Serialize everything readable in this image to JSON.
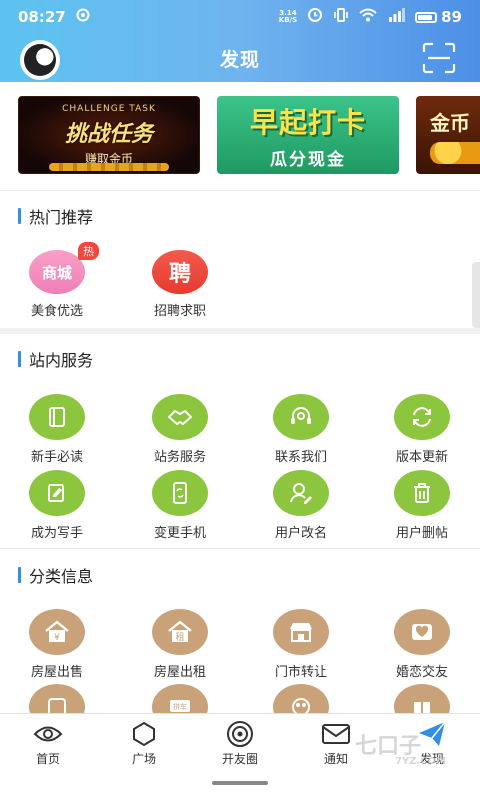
{
  "status_bar": {
    "time": "08:27",
    "net_speed_value": "3.14",
    "net_speed_unit": "KB/S",
    "battery": "89"
  },
  "header": {
    "title": "发现"
  },
  "banners": [
    {
      "tag": "CHALLENGE TASK",
      "main": "挑战任务",
      "sub": "赚取金币"
    },
    {
      "main": "早起打卡",
      "sub": "瓜分现金"
    },
    {
      "main": "金币"
    }
  ],
  "hot_section": {
    "title": "热门推荐",
    "items": [
      {
        "label": "美食优选",
        "icon_text": "商城",
        "badge": "热"
      },
      {
        "label": "招聘求职",
        "icon_text": "聘"
      }
    ]
  },
  "service_section": {
    "title": "站内服务",
    "items": [
      {
        "label": "新手必读",
        "icon": "book-icon"
      },
      {
        "label": "站务服务",
        "icon": "handshake-icon"
      },
      {
        "label": "联系我们",
        "icon": "headset-icon"
      },
      {
        "label": "版本更新",
        "icon": "refresh-icon"
      },
      {
        "label": "成为写手",
        "icon": "edit-icon"
      },
      {
        "label": "变更手机",
        "icon": "phone-icon"
      },
      {
        "label": "用户改名",
        "icon": "user-edit-icon"
      },
      {
        "label": "用户删帖",
        "icon": "trash-icon"
      }
    ]
  },
  "category_section": {
    "title": "分类信息",
    "items": [
      {
        "label": "房屋出售",
        "icon": "house-sale-icon",
        "icon_text": "¥"
      },
      {
        "label": "房屋出租",
        "icon": "house-rent-icon",
        "icon_text": "租"
      },
      {
        "label": "门市转让",
        "icon": "shop-icon"
      },
      {
        "label": "婚恋交友",
        "icon": "heart-icon"
      }
    ],
    "partial_items": [
      {
        "icon": "yuan-icon"
      },
      {
        "icon": "car-icon",
        "icon_text": "拼车"
      },
      {
        "icon": "people-icon"
      },
      {
        "icon": "gift-icon"
      }
    ]
  },
  "bottom_nav": [
    {
      "label": "首页",
      "icon": "eye-icon"
    },
    {
      "label": "广场",
      "icon": "hexagon-icon"
    },
    {
      "label": "开友圈",
      "icon": "circle-icon"
    },
    {
      "label": "通知",
      "icon": "mail-icon"
    },
    {
      "label": "发现",
      "icon": "paper-plane-icon"
    }
  ],
  "watermark": {
    "line1": "七口子",
    "line2": "7YZ.COM"
  },
  "colors": {
    "header_start": "#5cc3f0",
    "header_end": "#4d8fe6",
    "service_green": "#8cc63e",
    "category_tan": "#c9a27a",
    "accent_blue": "#2f8ee6"
  }
}
